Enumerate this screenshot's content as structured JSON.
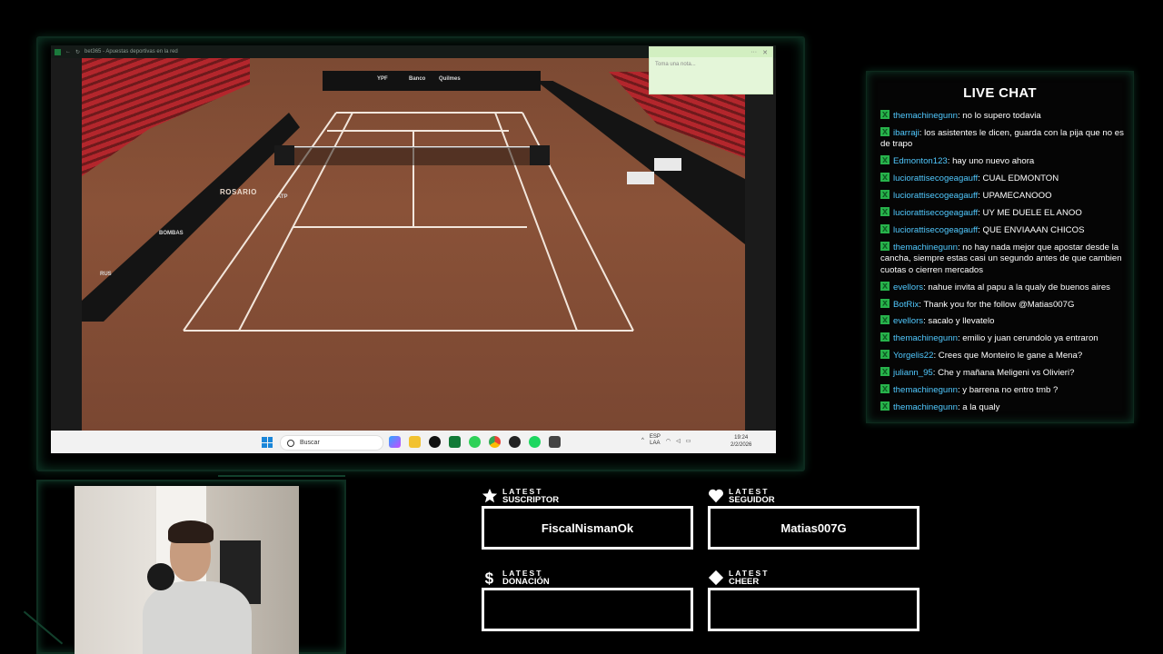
{
  "browser": {
    "tab_title": "bet365 - Apuestas deportivas en la red"
  },
  "video": {
    "venue_text": "ROSARIO",
    "sponsors": [
      "YPF",
      "Banco",
      "Quilmes",
      "ATP",
      "RUS",
      "BOMBAS"
    ]
  },
  "note": {
    "placeholder": "Toma una nota..."
  },
  "taskbar": {
    "search_label": "Buscar",
    "lang_top": "ESP",
    "lang_bottom": "LAA",
    "time": "19:24",
    "date": "2/2/2026"
  },
  "chat": {
    "title": "LIVE CHAT",
    "messages": [
      {
        "user": "themachinegunn",
        "text": "no lo supero todavia"
      },
      {
        "user": "ibarraji",
        "text": "los asistentes le dicen, guarda con la pija que no es de trapo"
      },
      {
        "user": "Edmonton123",
        "text": "hay uno nuevo ahora"
      },
      {
        "user": "luciorattisecogeagauff",
        "text": "CUAL EDMONTON"
      },
      {
        "user": "luciorattisecogeagauff",
        "text": "UPAMECANOOO"
      },
      {
        "user": "luciorattisecogeagauff",
        "text": "UY ME DUELE EL ANOO"
      },
      {
        "user": "luciorattisecogeagauff",
        "text": "QUE ENVIAAAN CHICOS"
      },
      {
        "user": "themachinegunn",
        "text": "no hay nada mejor que apostar desde la cancha, siempre estas casi un segundo antes de que cambien cuotas o cierren mercados"
      },
      {
        "user": "evellors",
        "text": "nahue invita al papu a la qualy de buenos aires"
      },
      {
        "user": "BotRix",
        "text": "Thank you for the follow @Matias007G"
      },
      {
        "user": "evellors",
        "text": "sacalo y llevatelo"
      },
      {
        "user": "themachinegunn",
        "text": "emilio y juan cerundolo ya entraron"
      },
      {
        "user": "Yorgelis22",
        "text": "Crees que Monteiro le gane a Mena?"
      },
      {
        "user": "juliann_95",
        "text": "Che y mañana Meligeni vs Olivieri?"
      },
      {
        "user": "themachinegunn",
        "text": "y barrena no entro tmb ?"
      },
      {
        "user": "themachinegunn",
        "text": "a la qualy"
      }
    ]
  },
  "alerts": {
    "suscriptor": {
      "small": "LATEST",
      "big": "SUSCRIPTOR",
      "value": "FiscalNismanOk",
      "icon": "star-icon"
    },
    "seguidor": {
      "small": "LATEST",
      "big": "SEGUIDOR",
      "value": "Matias007G",
      "icon": "heart-icon"
    },
    "donacion": {
      "small": "LATEST",
      "big": "DONACIÓN",
      "value": "",
      "icon": "dollar-icon"
    },
    "cheer": {
      "small": "LATEST",
      "big": "CHEER",
      "value": "",
      "icon": "diamond-icon"
    }
  },
  "colors": {
    "accent_green": "#27b34b",
    "chat_user": "#51c9ff",
    "frame_glow": "#0f3d2a"
  }
}
